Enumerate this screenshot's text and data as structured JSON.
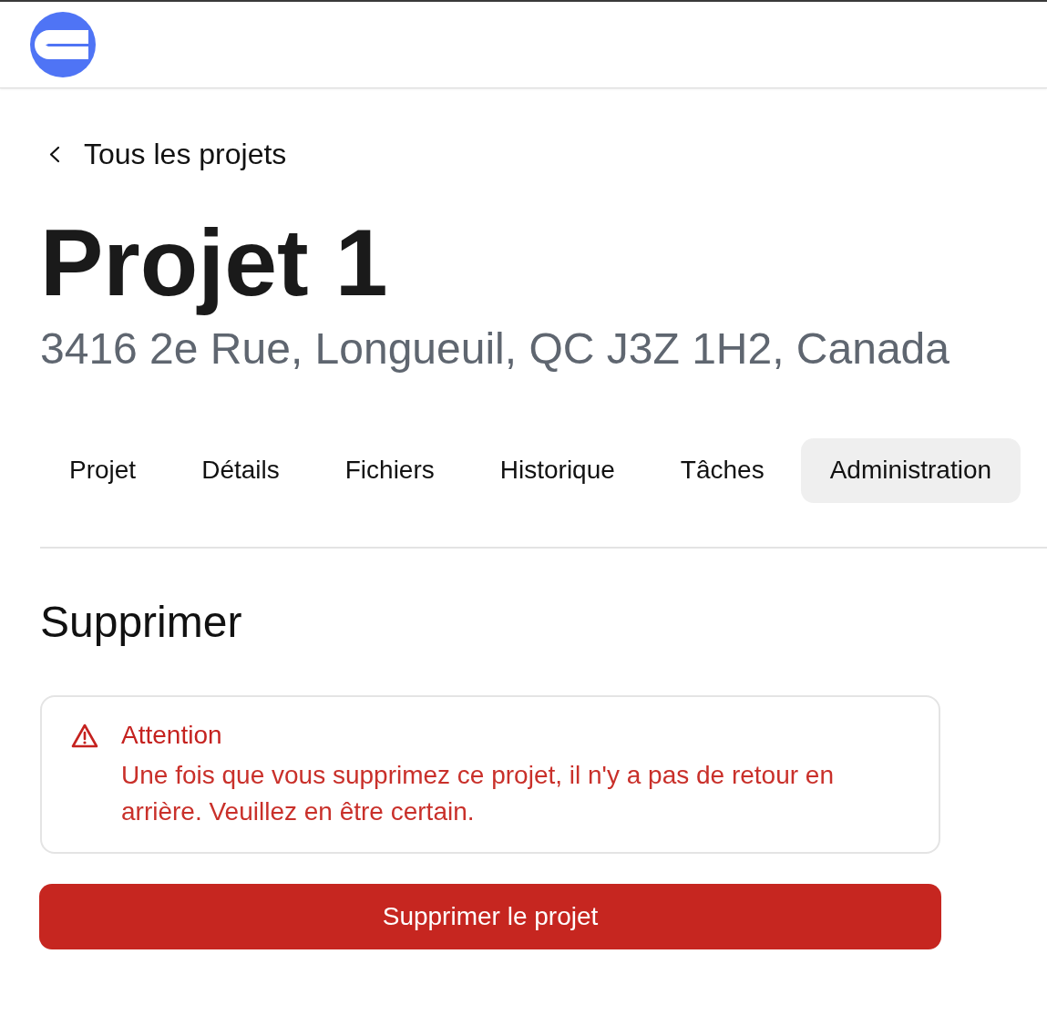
{
  "back_link": {
    "label": "Tous les projets"
  },
  "project": {
    "title": "Projet 1",
    "address": "3416 2e Rue, Longueuil, QC J3Z 1H2, Canada"
  },
  "tabs": [
    {
      "label": "Projet",
      "selected": false
    },
    {
      "label": "Détails",
      "selected": false
    },
    {
      "label": "Fichiers",
      "selected": false
    },
    {
      "label": "Historique",
      "selected": false
    },
    {
      "label": "Tâches",
      "selected": false
    },
    {
      "label": "Administration",
      "selected": true
    }
  ],
  "section": {
    "title": "Supprimer",
    "alert": {
      "title": "Attention",
      "message": "Une fois que vous supprimez ce projet, il n'y a pas de retour en arrière. Veuillez en être certain."
    },
    "button": {
      "label": "Supprimer le projet"
    }
  }
}
